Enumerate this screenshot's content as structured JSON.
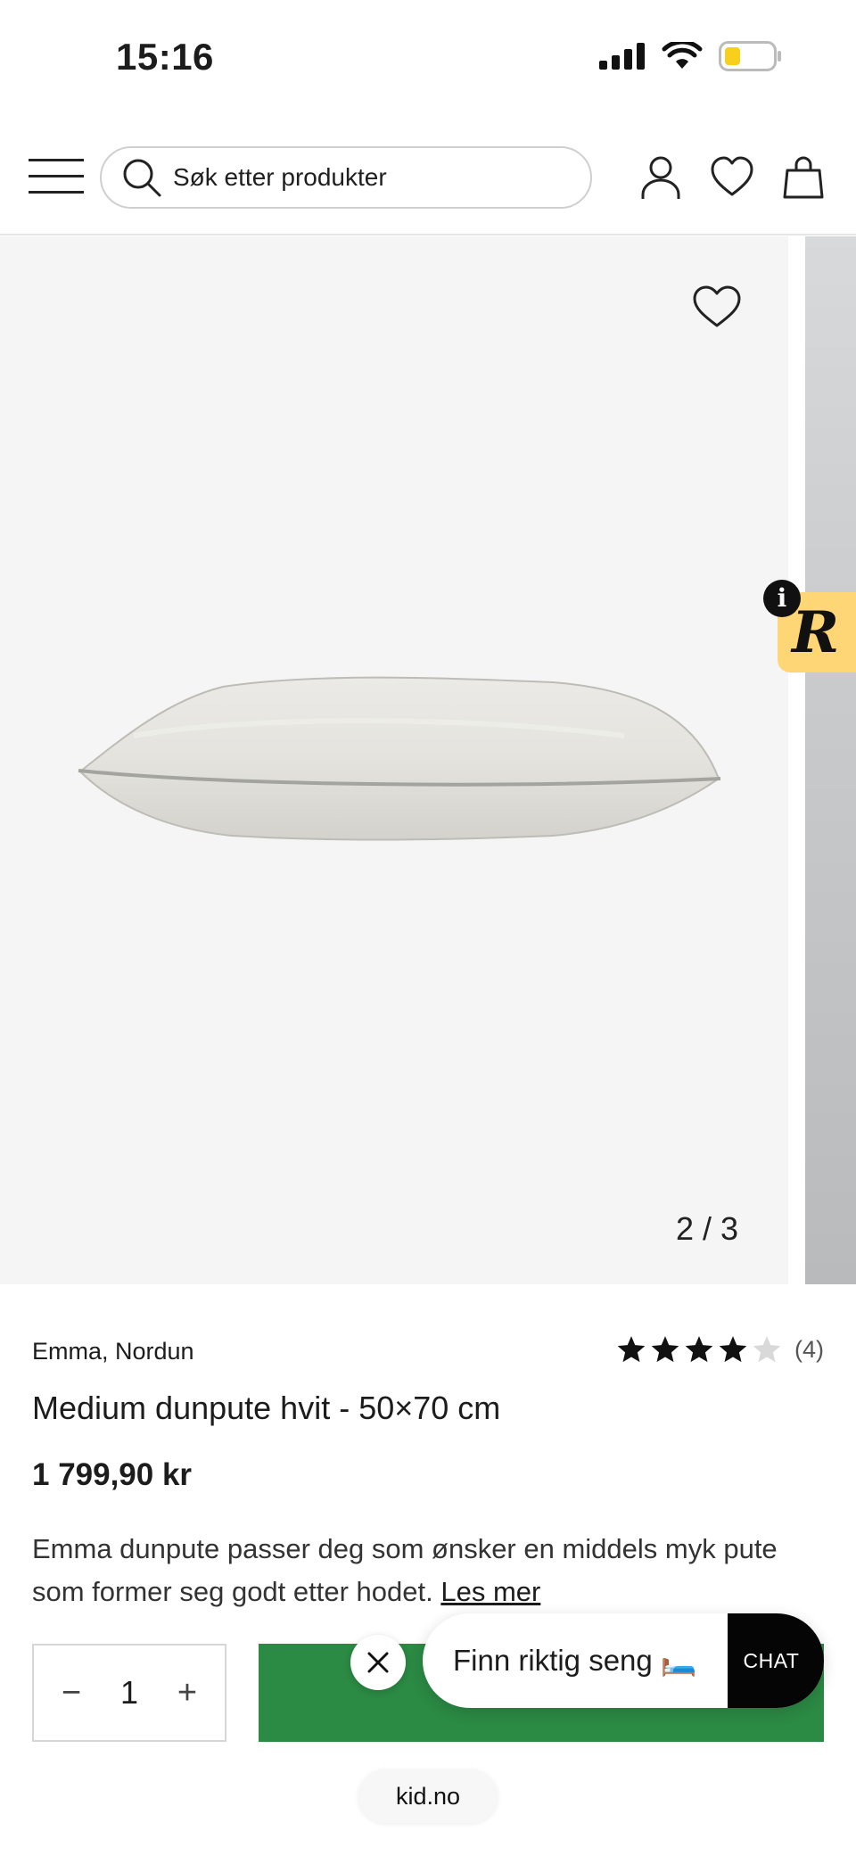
{
  "status_bar": {
    "time": "15:16"
  },
  "header": {
    "search_placeholder": "Søk etter produkter"
  },
  "gallery": {
    "counter": "2 / 3"
  },
  "product": {
    "brand": "Emma, Nordun",
    "rating": {
      "stars": 4,
      "max": 5,
      "count": "(4)"
    },
    "title": "Medium dunpute hvit - 50×70 cm",
    "price": "1 799,90 kr",
    "description": "Emma dunpute passer deg som ønsker en middels myk pute som former seg godt etter hodet.",
    "read_more": "Les mer"
  },
  "quantity": {
    "value": "1",
    "minus": "−",
    "plus": "+"
  },
  "chat": {
    "label": "Finn riktig seng 🛏️",
    "button": "CHAT"
  },
  "browser": {
    "url": "kid.no"
  },
  "colors": {
    "accent_green": "#2b8a44",
    "badge_yellow": "#ffd676",
    "battery_yellow": "#f8d01b"
  }
}
